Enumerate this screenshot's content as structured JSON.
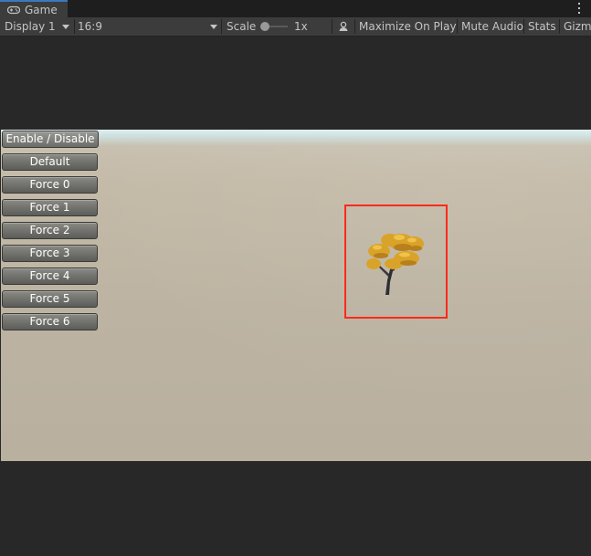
{
  "tab": {
    "title": "Game",
    "icon": "gamepad-icon"
  },
  "toolbar": {
    "display": "Display 1",
    "aspect": "16:9",
    "scale_label": "Scale",
    "scale_value": "1x",
    "maximize_on_play": "Maximize On Play",
    "mute_audio": "Mute Audio",
    "stats": "Stats",
    "gizmos": "Gizmos"
  },
  "buttons": [
    {
      "label": "Enable / Disable"
    },
    {
      "label": "Default"
    },
    {
      "label": "Force 0"
    },
    {
      "label": "Force 1"
    },
    {
      "label": "Force 2"
    },
    {
      "label": "Force 3"
    },
    {
      "label": "Force 4"
    },
    {
      "label": "Force 5"
    },
    {
      "label": "Force 6"
    }
  ],
  "colors": {
    "highlight": "#ff2a1a",
    "tab_accent": "#3a79bb",
    "foliage": "#d9a32a"
  }
}
